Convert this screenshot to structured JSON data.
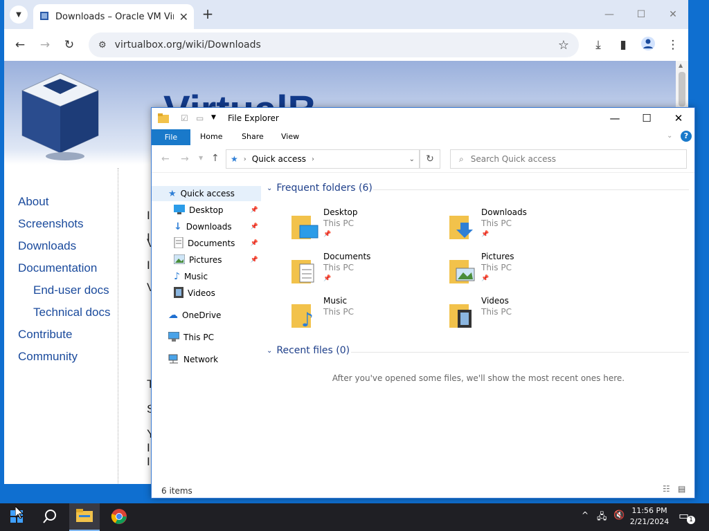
{
  "chrome": {
    "tab_title": "Downloads – Oracle VM VirtualBox",
    "url": "virtualbox.org/wiki/Downloads"
  },
  "page": {
    "site_title_visible": "VirtualB",
    "nav": [
      "About",
      "Screenshots",
      "Downloads",
      "Documentation",
      "End-user docs",
      "Technical docs",
      "Contribute",
      "Community"
    ],
    "fragments": [
      "I",
      "I",
      "V",
      "I",
      "V",
      "T",
      "S",
      "Y",
      "I",
      "I"
    ]
  },
  "explorer": {
    "title": "File Explorer",
    "ribbon_tabs": [
      "File",
      "Home",
      "Share",
      "View"
    ],
    "help": "?",
    "address": "Quick access",
    "search_placeholder": "Search Quick access",
    "nav_pane": [
      {
        "label": "Quick access",
        "pinned": false
      },
      {
        "label": "Desktop",
        "pinned": true
      },
      {
        "label": "Downloads",
        "pinned": true
      },
      {
        "label": "Documents",
        "pinned": true
      },
      {
        "label": "Pictures",
        "pinned": true
      },
      {
        "label": "Music",
        "pinned": false
      },
      {
        "label": "Videos",
        "pinned": false
      },
      {
        "label": "OneDrive",
        "pinned": false
      },
      {
        "label": "This PC",
        "pinned": false
      },
      {
        "label": "Network",
        "pinned": false
      }
    ],
    "frequent_header": "Frequent folders (6)",
    "folders": [
      {
        "name": "Desktop",
        "location": "This PC",
        "pinned": true
      },
      {
        "name": "Downloads",
        "location": "This PC",
        "pinned": true
      },
      {
        "name": "Documents",
        "location": "This PC",
        "pinned": true
      },
      {
        "name": "Pictures",
        "location": "This PC",
        "pinned": true
      },
      {
        "name": "Music",
        "location": "This PC",
        "pinned": false
      },
      {
        "name": "Videos",
        "location": "This PC",
        "pinned": false
      }
    ],
    "recent_header": "Recent files (0)",
    "recent_message": "After you've opened some files, we'll show the most recent ones here.",
    "status": "6 items"
  },
  "taskbar": {
    "time": "11:56 PM",
    "date": "2/21/2024",
    "notification_count": "1"
  },
  "colors": {
    "accent": "#1979ca",
    "desktop": "#0f6fd0",
    "taskbar": "#1f1f24",
    "link": "#1a4a9c"
  }
}
